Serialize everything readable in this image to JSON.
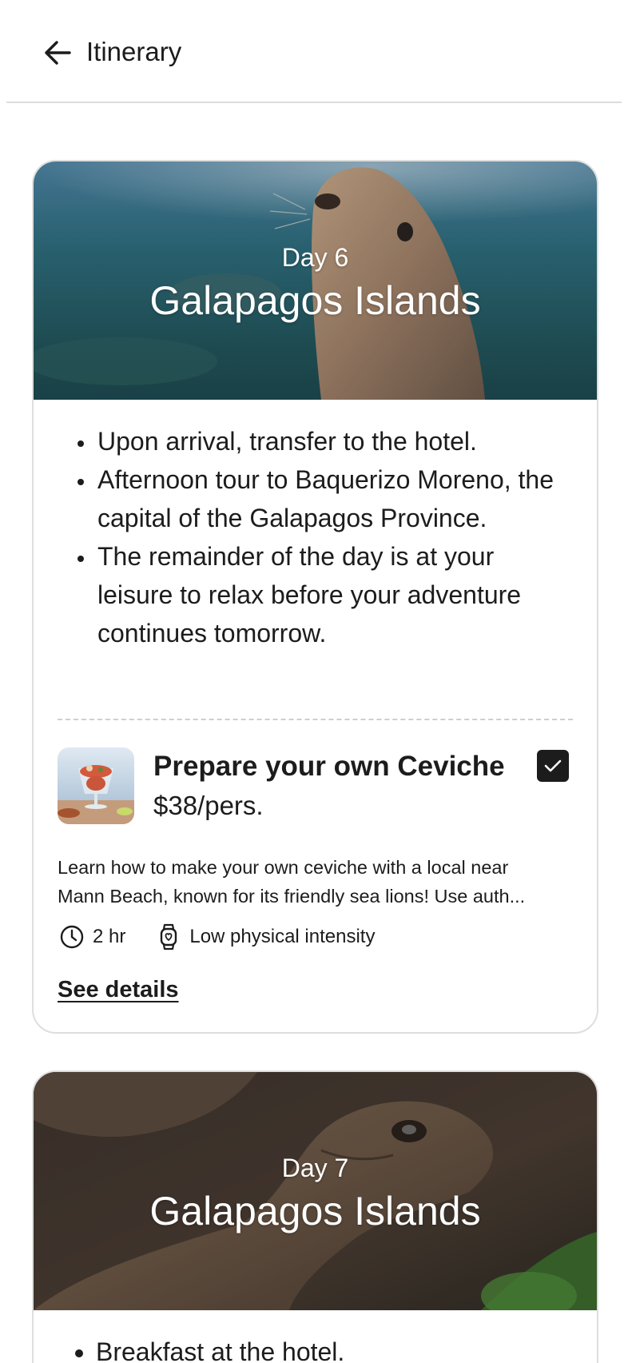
{
  "header": {
    "back_icon": "arrow-left-icon",
    "title": "Itinerary"
  },
  "days": [
    {
      "day_label": "Day 6",
      "place": "Galapagos Islands",
      "hero_image": "sea-lion-underwater",
      "bullets": [
        "Upon arrival, transfer to the hotel.",
        "Afternoon tour to Baquerizo Moreno, the capital of the Galapagos Province.",
        "The remainder of the day is at your leisure to relax before your adventure continues tomorrow."
      ],
      "addon": {
        "image": "ceviche-glass",
        "title": "Prepare your own Ceviche",
        "price": "$38/pers.",
        "checked": true,
        "description_line1": "Learn how to make your own ceviche with a local near",
        "description_line2": "Mann Beach, known for its friendly sea lions! Use auth...",
        "duration": "2 hr",
        "intensity": "Low physical intensity",
        "see_details": "See details"
      }
    },
    {
      "day_label": "Day 7",
      "place": "Galapagos Islands",
      "hero_image": "giant-tortoise",
      "bullets": [
        "Breakfast at the hotel."
      ]
    }
  ],
  "colors": {
    "text": "#1c1c1c",
    "border": "#dedede",
    "divider": "#cfcfcf"
  }
}
